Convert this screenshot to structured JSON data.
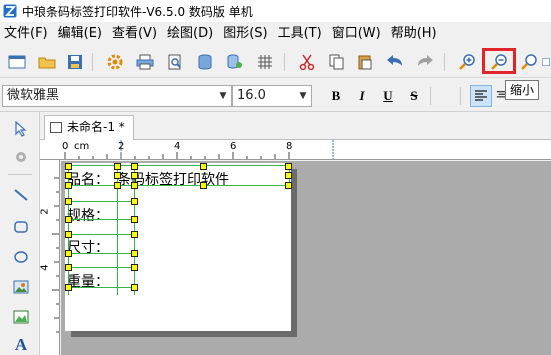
{
  "window": {
    "title": "中琅条码标签打印软件-V6.5.0 数码版 单机"
  },
  "menu": [
    {
      "label": "文件(F)"
    },
    {
      "label": "编辑(E)"
    },
    {
      "label": "查看(V)"
    },
    {
      "label": "绘图(D)"
    },
    {
      "label": "图形(S)"
    },
    {
      "label": "工具(T)"
    },
    {
      "label": "窗口(W)"
    },
    {
      "label": "帮助(H)"
    }
  ],
  "format_bar": {
    "font_name": "微软雅黑",
    "font_size": "16.0",
    "bold": "B",
    "italic": "I",
    "underline": "U",
    "strikethrough": "S"
  },
  "tooltip": "缩小",
  "document": {
    "tab_label": "未命名-1 *"
  },
  "ruler": {
    "unit": "cm",
    "top_ticks": [
      "0",
      "2",
      "4",
      "6",
      "8"
    ],
    "left_ticks": [
      "2",
      "4"
    ]
  },
  "label_fields": [
    {
      "text": "品名："
    },
    {
      "text": "条码标签打印软件"
    },
    {
      "text": "规格："
    },
    {
      "text": "尺寸："
    },
    {
      "text": "重量："
    }
  ],
  "colors": {
    "highlight": "#e0262b",
    "guide_line": "#35b54a",
    "selection_handle": "#ffff00",
    "canvas": "#ababab"
  }
}
